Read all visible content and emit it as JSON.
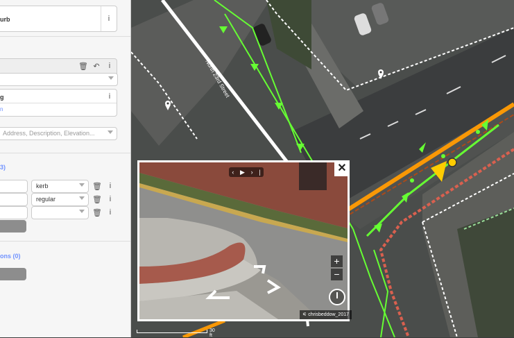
{
  "sidebar": {
    "feature_title": "urb",
    "info_icon": "i",
    "field_actions": {
      "trash": "🗑",
      "undo": "↶",
      "info": "i"
    },
    "tag_label": "g",
    "tag_info": "i",
    "tag_link": "n",
    "add_field_placeholder": "Address, Description, Elevation...",
    "section_relations_count": "3)",
    "rows": [
      {
        "value": "kerb"
      },
      {
        "value": "regular"
      },
      {
        "value": ""
      }
    ],
    "section_members": "ons (0)"
  },
  "viewer": {
    "close": "✕",
    "controls": [
      "‹",
      "▶",
      "›",
      "|"
    ],
    "zoom_in": "+",
    "zoom_out": "−",
    "attribution": "chrisbeddow_2017"
  },
  "map": {
    "street_label": "North 23rd Street",
    "scale_label": "30 ft"
  },
  "colors": {
    "way_green": "#66ff33",
    "selected": "#ffcc00",
    "road_orange": "#f99806"
  }
}
